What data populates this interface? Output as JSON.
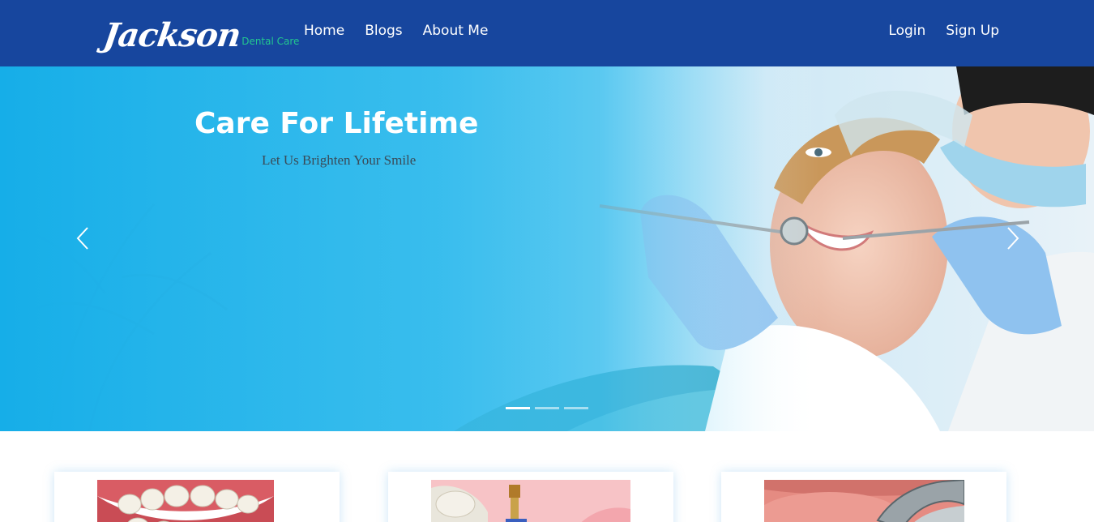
{
  "brand": {
    "logo_text": "Jackson",
    "subtitle": "Dental Care"
  },
  "nav": {
    "left": [
      {
        "label": "Home"
      },
      {
        "label": "Blogs"
      },
      {
        "label": "About Me"
      }
    ],
    "right": [
      {
        "label": "Login"
      },
      {
        "label": "Sign Up"
      }
    ]
  },
  "hero": {
    "title": "Care For Lifetime",
    "subtitle": "Let Us Brighten Your Smile",
    "active_slide": 1,
    "slide_count": 3
  },
  "cards": [
    {
      "image": "teeth-model-image"
    },
    {
      "image": "dental-implant-image"
    },
    {
      "image": "dental-procedure-image"
    }
  ],
  "colors": {
    "navbar": "#17469e",
    "brand_accent": "#22c78f",
    "hero_blue": "#16aee8"
  },
  "icons": {
    "prev": "chevron-left-icon",
    "next": "chevron-right-icon"
  }
}
